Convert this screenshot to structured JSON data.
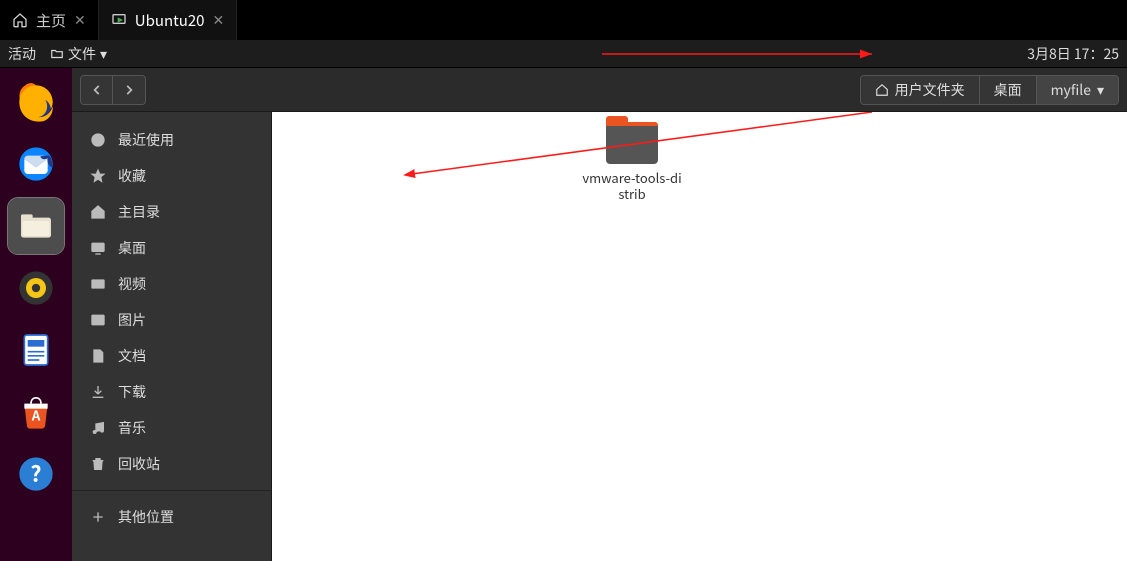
{
  "vm_tabs": {
    "home": "主页",
    "active": "Ubuntu20"
  },
  "topbar": {
    "activities": "活动",
    "files_menu": "文件",
    "clock": "3月8日  17：25"
  },
  "breadcrumb": {
    "home": "用户文件夹",
    "desktop": "桌面",
    "myfile": "myfile"
  },
  "sidebar": {
    "recent": "最近使用",
    "starred": "收藏",
    "home": "主目录",
    "desktop": "桌面",
    "videos": "视频",
    "pictures": "图片",
    "documents": "文档",
    "downloads": "下载",
    "music": "音乐",
    "trash": "回收站",
    "other": "其他位置"
  },
  "files": {
    "folder1": "vmware-tools-distrib"
  }
}
